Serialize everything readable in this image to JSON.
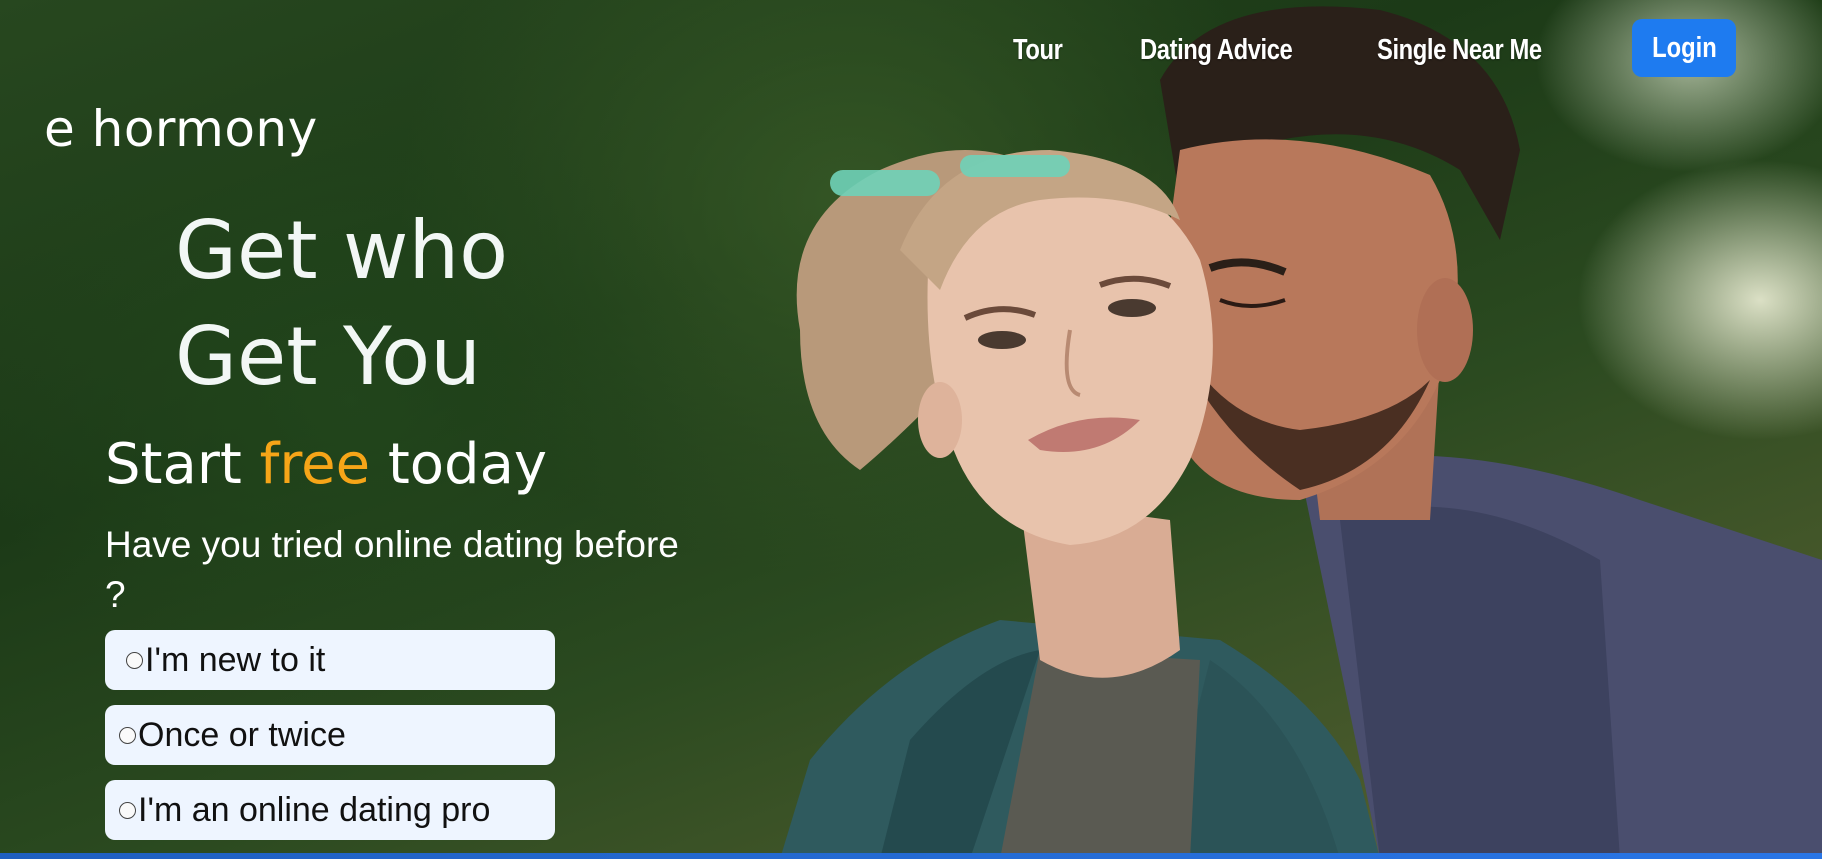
{
  "nav": {
    "links": [
      "Tour",
      "Dating Advice",
      "Single Near Me"
    ],
    "login_label": "Login"
  },
  "brand": {
    "logo_text": "e hormony"
  },
  "hero": {
    "headline_line1": "Get who",
    "headline_line2": "Get You",
    "subhead_before": "Start ",
    "subhead_accent": "free",
    "subhead_after": " today",
    "question": "Have you tried online dating before ?",
    "options": [
      "I'm new to it",
      "Once or twice",
      "I'm an online dating pro"
    ],
    "image": "couple-photo"
  },
  "colors": {
    "accent": "#f6a518",
    "login_button": "#1e7bf0",
    "option_bg": "#eef5ff",
    "bottom_bar": "#2a76e6"
  }
}
